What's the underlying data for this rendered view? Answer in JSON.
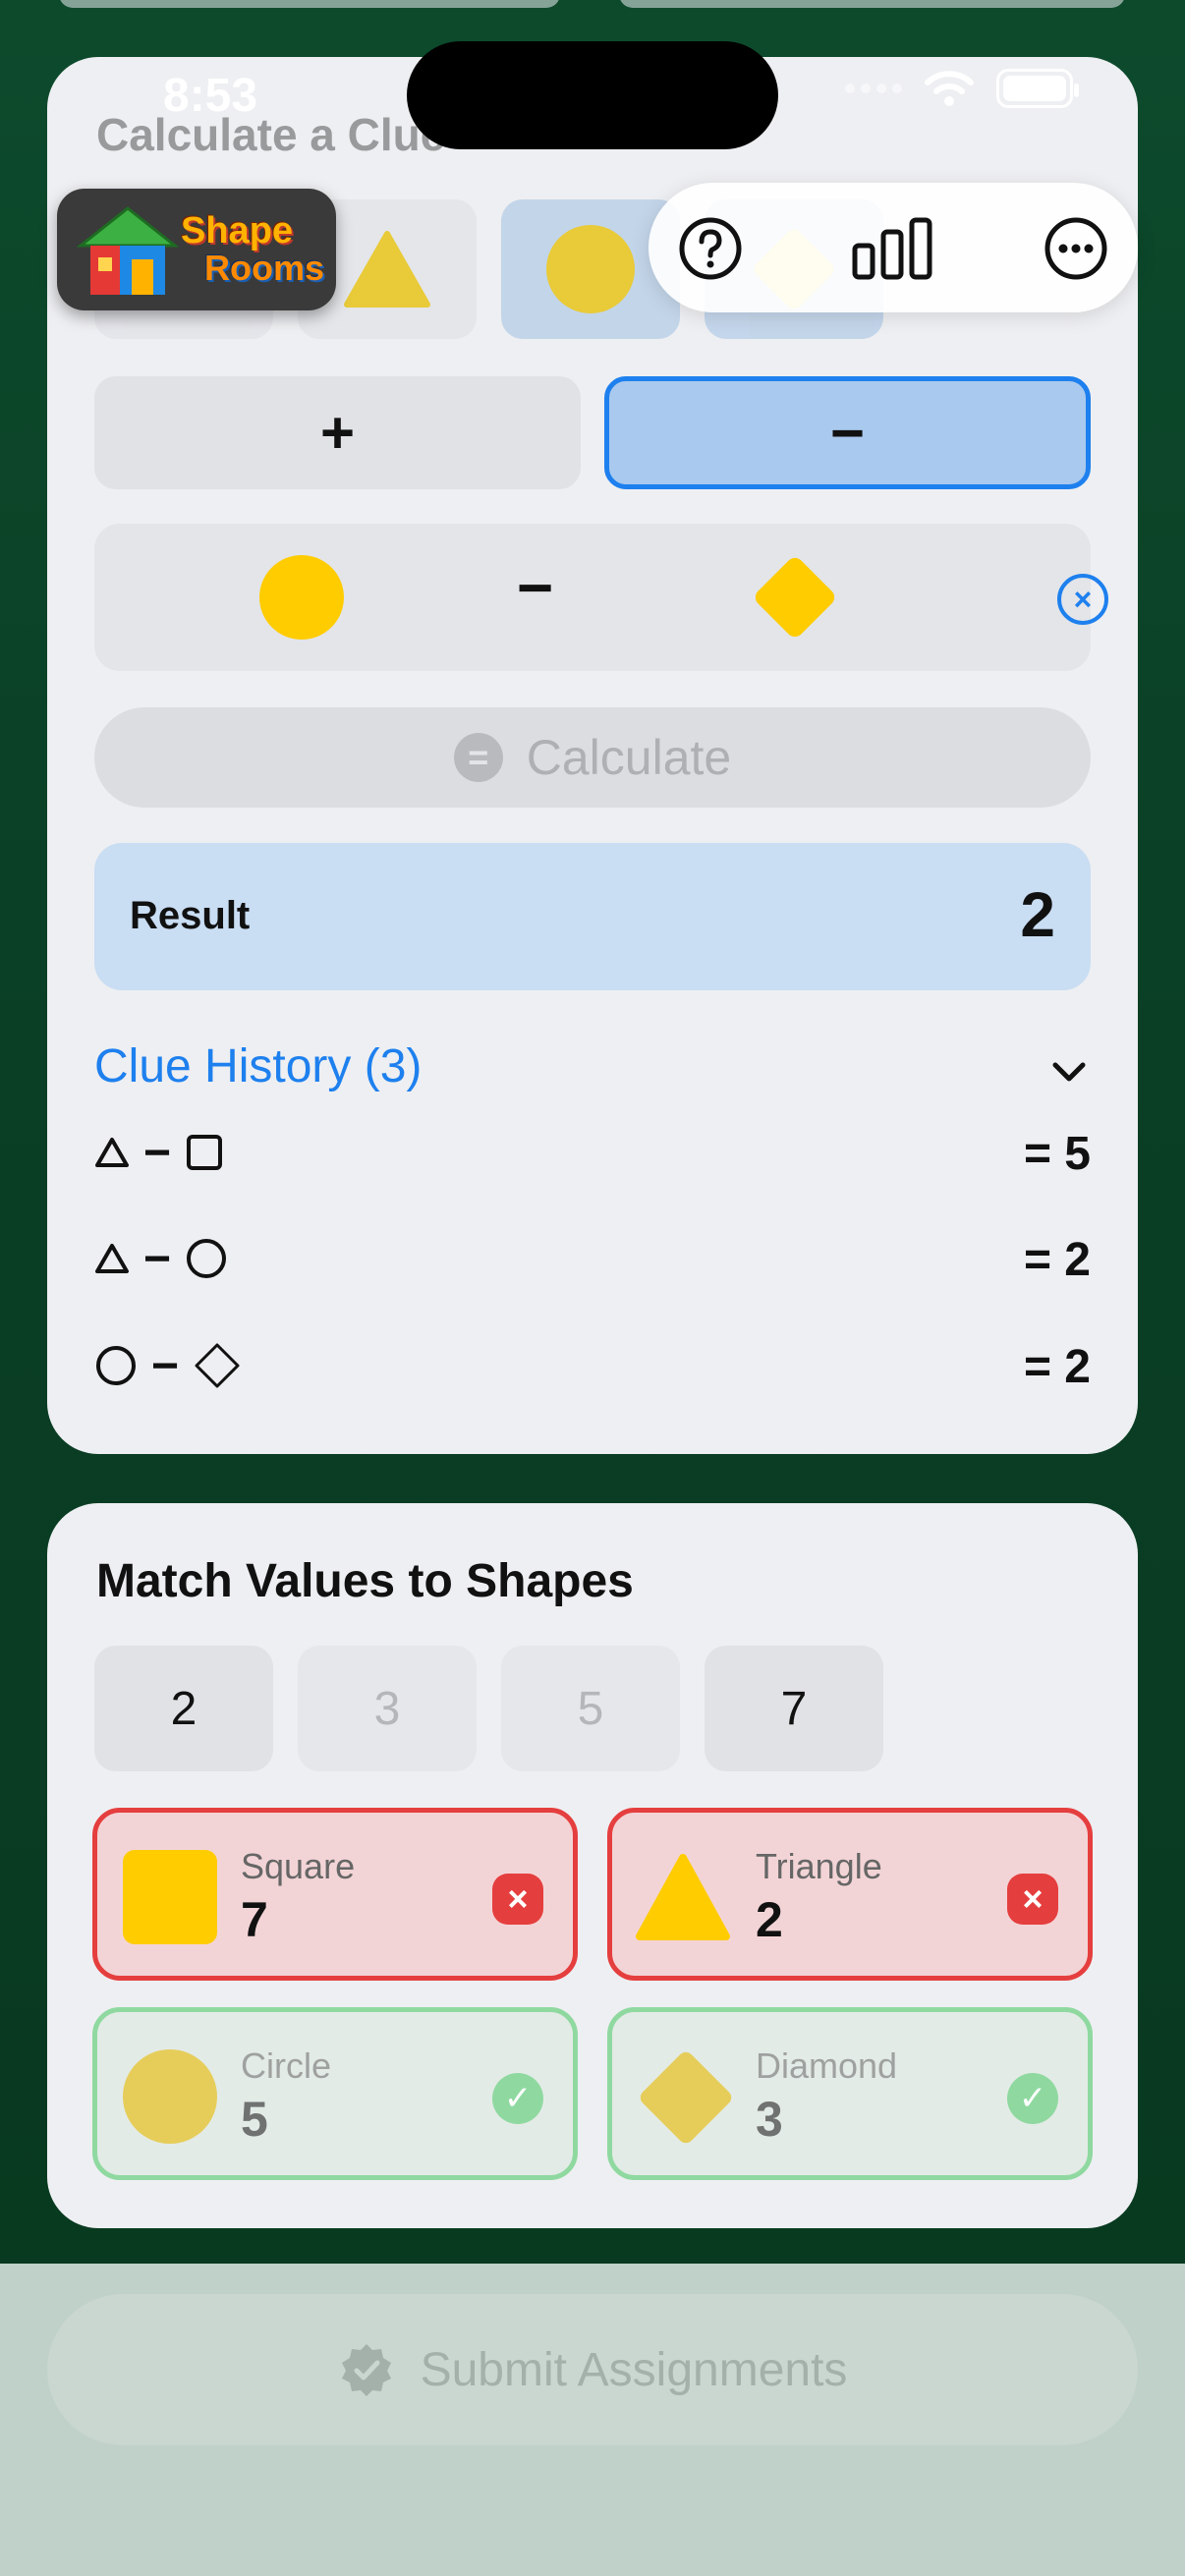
{
  "status_bar": {
    "time": "8:53"
  },
  "logo": {
    "line1": "Shape",
    "line2": "Rooms"
  },
  "toolbar": {
    "help_icon": "question-circle-icon",
    "stats_icon": "bar-chart-icon",
    "more_icon": "ellipsis-circle-icon"
  },
  "calculator": {
    "title": "Calculate a Clue",
    "shapes": [
      "square",
      "triangle",
      "circle",
      "diamond"
    ],
    "selected_shape": "circle",
    "operators": {
      "plus": "+",
      "minus": "−"
    },
    "selected_operator": "minus",
    "expression": {
      "left": "circle",
      "operator": "−",
      "right": "diamond"
    },
    "calculate_label": "Calculate",
    "result_label": "Result",
    "result_value": "2"
  },
  "history": {
    "title": "Clue History (3)",
    "rows": [
      {
        "left": "triangle",
        "op": "−",
        "right": "square",
        "result": "= 5"
      },
      {
        "left": "triangle",
        "op": "−",
        "right": "circle",
        "result": "= 2"
      },
      {
        "left": "circle",
        "op": "−",
        "right": "diamond",
        "result": "= 2"
      }
    ]
  },
  "match": {
    "title": "Match Values to Shapes",
    "values": [
      {
        "label": "2",
        "used": false
      },
      {
        "label": "3",
        "used": true
      },
      {
        "label": "5",
        "used": true
      },
      {
        "label": "7",
        "used": false
      }
    ],
    "assignments": [
      {
        "shape": "Square",
        "value": "7",
        "status": "wrong"
      },
      {
        "shape": "Triangle",
        "value": "2",
        "status": "wrong"
      },
      {
        "shape": "Circle",
        "value": "5",
        "status": "correct"
      },
      {
        "shape": "Diamond",
        "value": "3",
        "status": "correct"
      }
    ]
  },
  "submit": {
    "label": "Submit Assignments"
  },
  "colors": {
    "accent": "#1e80ee",
    "shape_yellow": "#ffcc00",
    "error": "#e53e3e",
    "success": "#8fd9a0",
    "background": "#0a3f25"
  }
}
